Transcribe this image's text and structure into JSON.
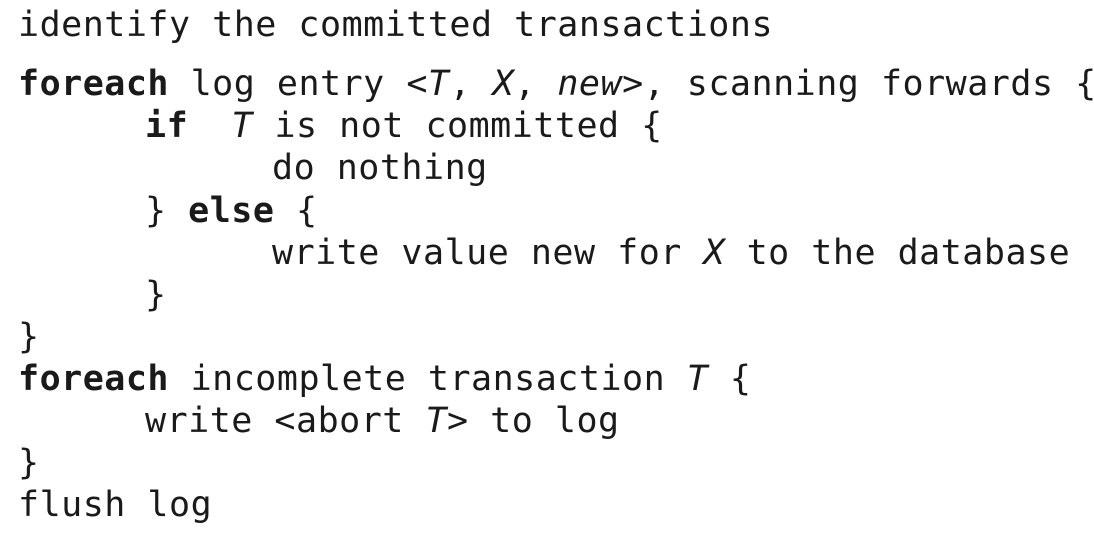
{
  "lines": [
    {
      "name": "line-identify",
      "indent": 0,
      "segments": [
        {
          "text": "identify the committed transactions",
          "style": ""
        }
      ]
    },
    {
      "name": "line-foreach-log",
      "indent": 0,
      "segments": [
        {
          "text": "foreach",
          "style": "kw"
        },
        {
          "text": " log entry ",
          "style": ""
        },
        {
          "text": "<",
          "style": ""
        },
        {
          "text": "T",
          "style": "it"
        },
        {
          "text": ", ",
          "style": ""
        },
        {
          "text": "X",
          "style": "it"
        },
        {
          "text": ", ",
          "style": ""
        },
        {
          "text": "new",
          "style": "it"
        },
        {
          "text": ">, scanning forwards {",
          "style": ""
        }
      ]
    },
    {
      "name": "line-if",
      "indent": 1,
      "segments": [
        {
          "text": "if",
          "style": "kw"
        },
        {
          "text": "  ",
          "style": ""
        },
        {
          "text": "T",
          "style": "it"
        },
        {
          "text": " is not committed {",
          "style": ""
        }
      ]
    },
    {
      "name": "line-do-nothing",
      "indent": 2,
      "segments": [
        {
          "text": "do nothing",
          "style": ""
        }
      ]
    },
    {
      "name": "line-else",
      "indent": 1,
      "segments": [
        {
          "text": "} ",
          "style": ""
        },
        {
          "text": "else",
          "style": "kw"
        },
        {
          "text": " {",
          "style": ""
        }
      ]
    },
    {
      "name": "line-write-value",
      "indent": 2,
      "segments": [
        {
          "text": "write value new for ",
          "style": ""
        },
        {
          "text": "X",
          "style": "it"
        },
        {
          "text": " to the database",
          "style": ""
        }
      ]
    },
    {
      "name": "line-close-if",
      "indent": 1,
      "segments": [
        {
          "text": "}",
          "style": ""
        }
      ]
    },
    {
      "name": "line-close-foreach-1",
      "indent": 0,
      "segments": [
        {
          "text": "}",
          "style": ""
        }
      ]
    },
    {
      "name": "line-foreach-incomplete",
      "indent": 0,
      "segments": [
        {
          "text": "foreach",
          "style": "kw"
        },
        {
          "text": " incomplete transaction ",
          "style": ""
        },
        {
          "text": "T",
          "style": "it"
        },
        {
          "text": " {",
          "style": ""
        }
      ]
    },
    {
      "name": "line-write-abort",
      "indent": 1,
      "segments": [
        {
          "text": "write <abort ",
          "style": ""
        },
        {
          "text": "T",
          "style": "it"
        },
        {
          "text": "> to log",
          "style": ""
        }
      ]
    },
    {
      "name": "line-close-foreach-2",
      "indent": 0,
      "segments": [
        {
          "text": "}",
          "style": ""
        }
      ]
    },
    {
      "name": "line-flush",
      "indent": 0,
      "segments": [
        {
          "text": "flush log",
          "style": ""
        }
      ]
    }
  ]
}
